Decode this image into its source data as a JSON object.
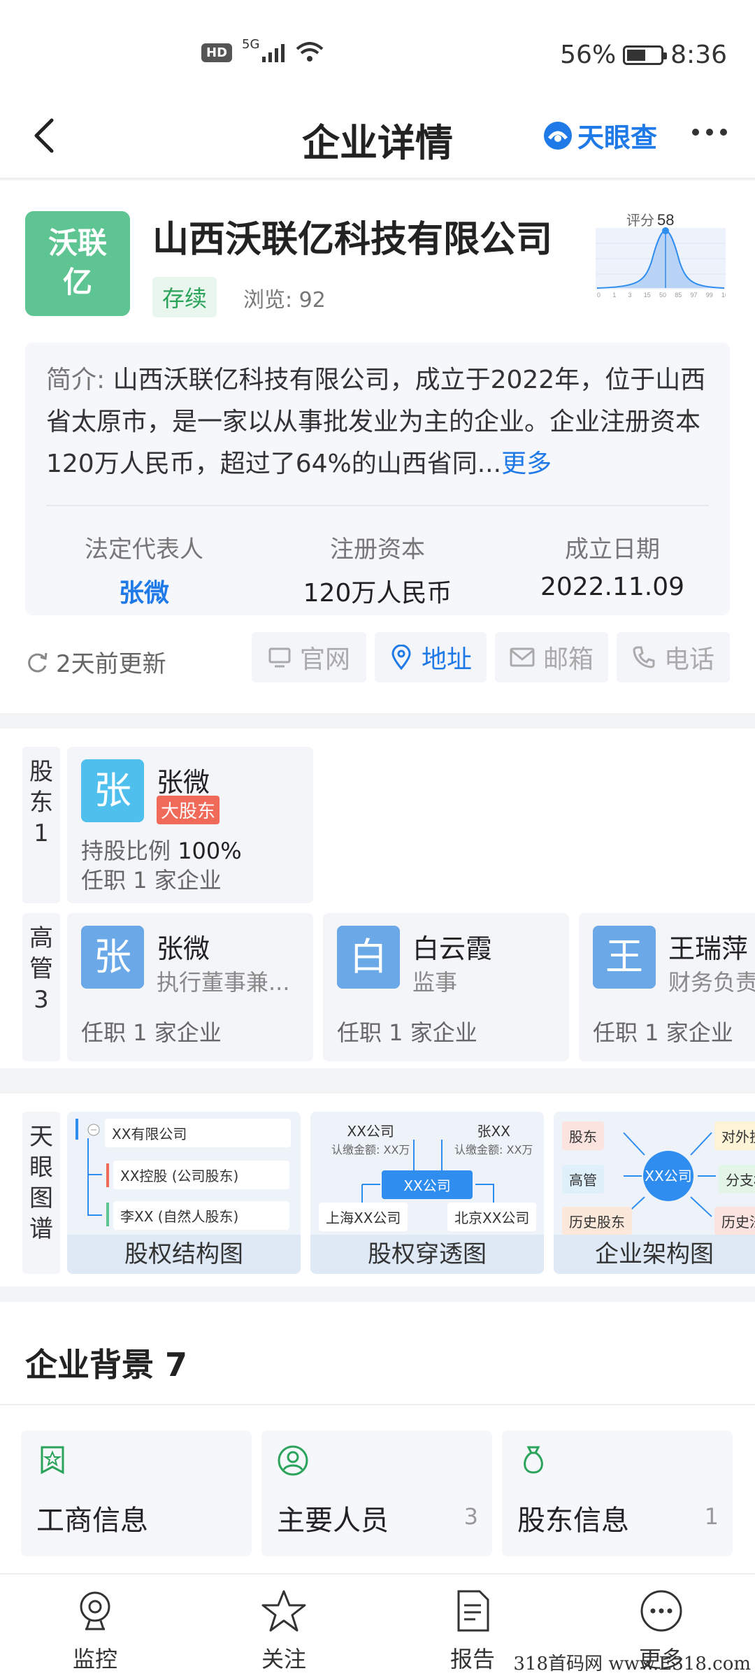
{
  "status_bar": {
    "hd": "HD",
    "net": "5G",
    "battery": "56%",
    "battery_level": 0.56,
    "time": "8:36"
  },
  "header": {
    "title": "企业详情",
    "brand": "天眼查"
  },
  "company": {
    "logo_line1": "沃联",
    "logo_line2": "亿",
    "name": "山西沃联亿科技有限公司",
    "status": "存续",
    "views": "浏览: 92",
    "score_label": "评分",
    "score_value": "58",
    "score_ticks": [
      "0",
      "1",
      "3",
      "15",
      "50",
      "85",
      "97",
      "99",
      "100"
    ],
    "intro_label": "简介:",
    "intro_text": "山西沃联亿科技有限公司，成立于2022年，位于山西省太原市，是一家以从事批发业为主的企业。企业注册资本120万人民币，超过了64%的山西省同...",
    "intro_more": "更多",
    "legal_rep_label": "法定代表人",
    "legal_rep_value": "张微",
    "capital_label": "注册资本",
    "capital_value": "120万人民币",
    "founded_label": "成立日期",
    "founded_value": "2022.11.09",
    "updated": "2天前更新",
    "actions": [
      {
        "label": "官网",
        "icon": "monitor-icon"
      },
      {
        "label": "地址",
        "icon": "location-icon"
      },
      {
        "label": "邮箱",
        "icon": "mail-icon"
      },
      {
        "label": "电话",
        "icon": "phone-icon"
      }
    ]
  },
  "shareholders": {
    "label": "股东1",
    "items": [
      {
        "avatar": "张",
        "name": "张微",
        "tag": "大股东",
        "ratio_label": "持股比例",
        "ratio": "100%",
        "jobs": "任职 1 家企业"
      }
    ]
  },
  "executives": {
    "label": "高管3",
    "items": [
      {
        "avatar": "张",
        "name": "张微",
        "role": "执行董事兼...",
        "jobs": "任职 1 家企业"
      },
      {
        "avatar": "白",
        "name": "白云霞",
        "role": "监事",
        "jobs": "任职 1 家企业"
      },
      {
        "avatar": "王",
        "name": "王瑞萍",
        "role": "财务负责",
        "jobs": "任职 1 家企业"
      }
    ]
  },
  "maps": {
    "label": "天眼图谱",
    "cards": [
      {
        "caption": "股权结构图",
        "nodes": [
          "XX有限公司",
          "XX控股 (公司股东)",
          "李XX (自然人股东)"
        ]
      },
      {
        "caption": "股权穿透图",
        "nodes": [
          "XX公司",
          "认缴金额: XX万",
          "张XX",
          "认缴金额: XX万",
          "XX公司",
          "上海XX公司",
          "北京XX公司"
        ]
      },
      {
        "caption": "企业架构图",
        "nodes": [
          "股东",
          "高管",
          "历史股东",
          "XX公司",
          "对外投",
          "分支机",
          "历史法"
        ]
      }
    ]
  },
  "background": {
    "title": "企业背景 7",
    "tiles": [
      {
        "name": "工商信息",
        "count": ""
      },
      {
        "name": "主要人员",
        "count": "3"
      },
      {
        "name": "股东信息",
        "count": "1"
      }
    ]
  },
  "nav": [
    {
      "label": "监控",
      "icon": "monitor-camera-icon"
    },
    {
      "label": "关注",
      "icon": "star-icon"
    },
    {
      "label": "报告",
      "icon": "report-icon"
    },
    {
      "label": "更多",
      "icon": "more-icon"
    }
  ],
  "watermark": "318首码网 www.E318.com"
}
